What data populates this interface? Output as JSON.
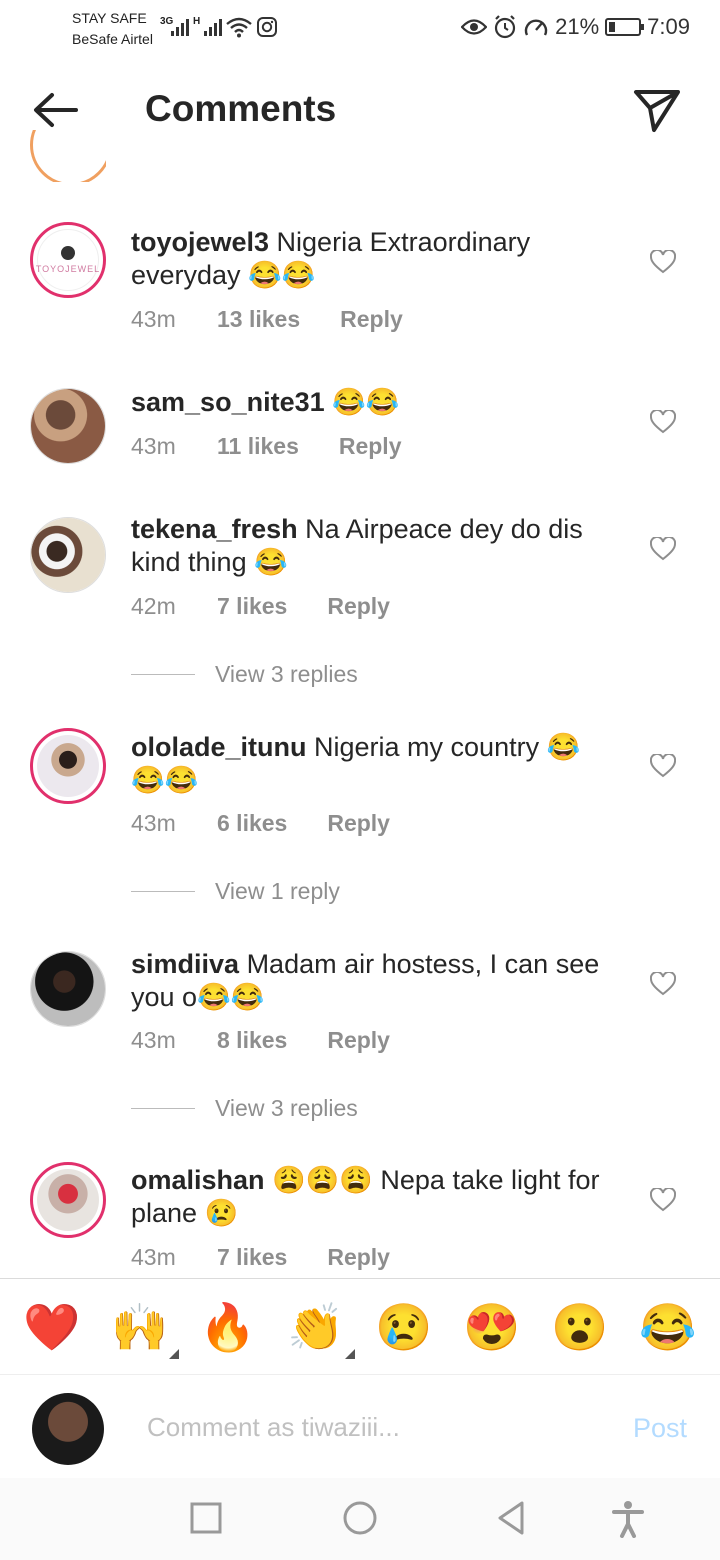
{
  "status_bar": {
    "carrier_line1": "STAY SAFE",
    "carrier_line2": "BeSafe Airtel",
    "network1": "3G",
    "network2": "H",
    "battery_percent": "21%",
    "battery_level": 0.21,
    "time": "7:09"
  },
  "header": {
    "title": "Comments"
  },
  "comments": [
    {
      "username": "toyojewel3",
      "text": " Nigeria Extraordinary everyday 😂😂",
      "time": "43m",
      "likes": "13 likes",
      "reply": "Reply",
      "avatar_label": "TOYOJEWEL"
    },
    {
      "username": "sam_so_nite31",
      "text": " 😂😂",
      "time": "43m",
      "likes": "11 likes",
      "reply": "Reply"
    },
    {
      "username": "tekena_fresh",
      "text": " Na Airpeace dey do dis kind thing 😂",
      "time": "42m",
      "likes": "7 likes",
      "reply": "Reply",
      "view_replies": "View 3 replies"
    },
    {
      "username": "ololade_itunu",
      "text": " Nigeria my country 😂😂😂",
      "time": "43m",
      "likes": "6 likes",
      "reply": "Reply",
      "view_replies": "View 1 reply"
    },
    {
      "username": "simdiiva",
      "text": " Madam air hostess, I can see you o😂😂",
      "time": "43m",
      "likes": "8 likes",
      "reply": "Reply",
      "view_replies": "View 3 replies"
    },
    {
      "username": "omalishan",
      "text": " 😩😩😩 Nepa take light for plane 😢",
      "time": "43m",
      "likes": "7 likes",
      "reply": "Reply"
    }
  ],
  "emoji_bar": [
    "❤️",
    "🙌",
    "🔥",
    "👏",
    "😢",
    "😍",
    "😮",
    "😂"
  ],
  "composer": {
    "placeholder": "Comment as tiwaziii...",
    "post_label": "Post"
  },
  "colors": {
    "story_ring": "#e1306c",
    "post_disabled": "#b3dbff",
    "meta_gray": "#8e8e8e"
  }
}
